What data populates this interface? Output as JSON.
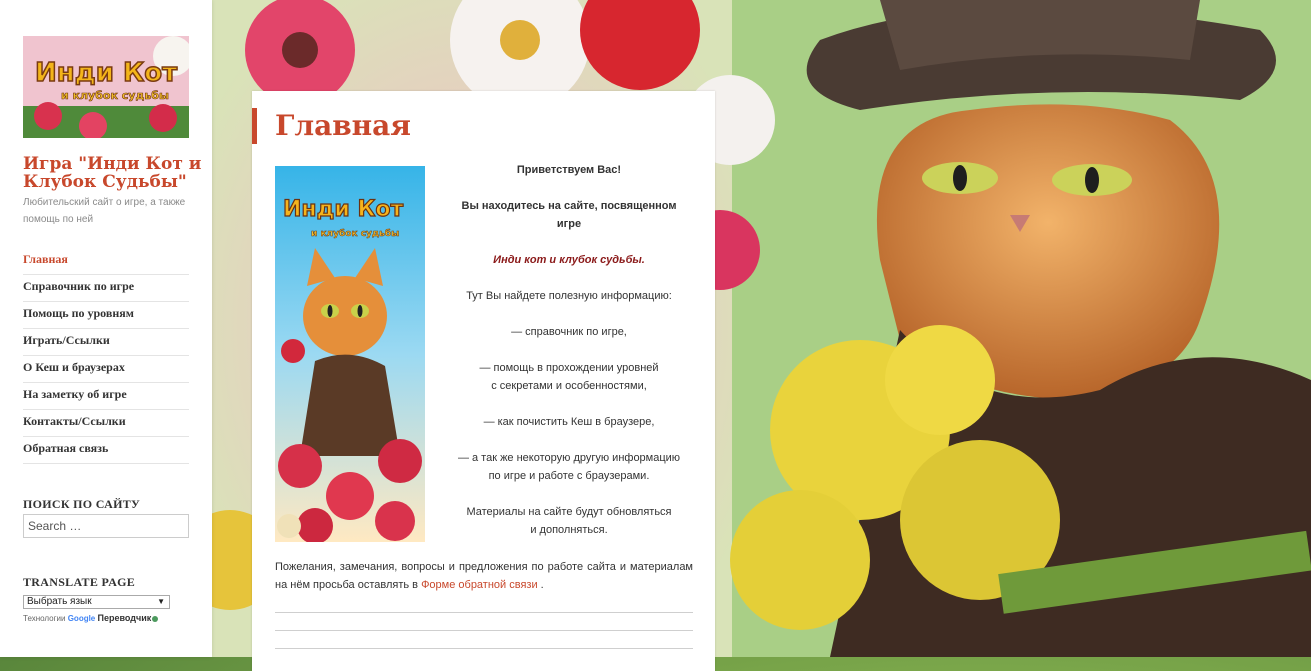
{
  "site": {
    "title": "Игра \"Инди Кот и Клубок Судьбы\"",
    "description": "Любительский сайт о игре, а также помощь по ней",
    "logo_text_line1": "Инди Кот",
    "logo_text_line2": "и клубок судьбы"
  },
  "nav": [
    {
      "label": "Главная",
      "active": true
    },
    {
      "label": "Справочник по игре",
      "active": false
    },
    {
      "label": "Помощь по уровням",
      "active": false
    },
    {
      "label": "Играть/Ссылки",
      "active": false
    },
    {
      "label": "О Кеш и браузерах",
      "active": false
    },
    {
      "label": "На заметку об игре",
      "active": false
    },
    {
      "label": "Контакты/Ссылки",
      "active": false
    },
    {
      "label": "Обратная связь",
      "active": false
    }
  ],
  "search": {
    "heading": "ПОИСК ПО САЙТУ",
    "placeholder": "Search …"
  },
  "translate": {
    "heading": "TRANSLATE PAGE",
    "select_value": "Выбрать язык",
    "powered_prefix": "Технологии",
    "google": "Google",
    "service": "Переводчик"
  },
  "page": {
    "title": "Главная",
    "poster_title_line1": "Инди Кот",
    "poster_title_line2": "и клубок судьбы",
    "greeting": "Приветствуем Вас!",
    "intro": "Вы находитесь на сайте, посвященном игре",
    "game_name": "Инди кот и клубок судьбы.",
    "useful": "Тут Вы найдете полезную информацию:",
    "item1": "— справочник по игре,",
    "item2_line1": "— помощь в прохождении уровней",
    "item2_line2": "с секретами и особенностями,",
    "item3": "— как почистить Кеш в браузере,",
    "item4_line1": "— а так же некоторую другую информацию",
    "item4_line2": "по игре и работе с браузерами.",
    "updates_line1": "Материалы на сайте будут обновляться",
    "updates_line2": "и дополняться.",
    "footnote_text": "Пожелания, замечания, вопросы и предложения по работе сайта и материалам на нём просьба оставлять в",
    "footnote_link": "Форме обратной связи",
    "footnote_end": "."
  },
  "colors": {
    "accent": "#c8482c",
    "text": "#333333",
    "game_name": "#8b1a1a"
  }
}
